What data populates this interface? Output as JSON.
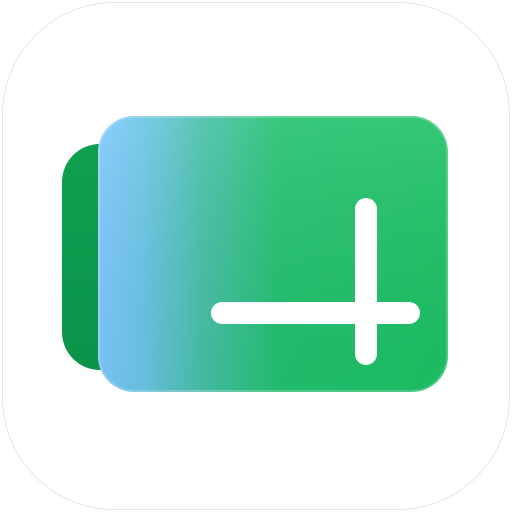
{
  "app_icon": {
    "name": "add-tab-icon",
    "background_color": "#ffffff",
    "border_color": "#e8e8ea",
    "colors": {
      "back_card": "#0e9f4e",
      "front_card_green": "#1dc265",
      "front_card_blue": "#7fc8ff",
      "plus": "#ffffff"
    }
  }
}
